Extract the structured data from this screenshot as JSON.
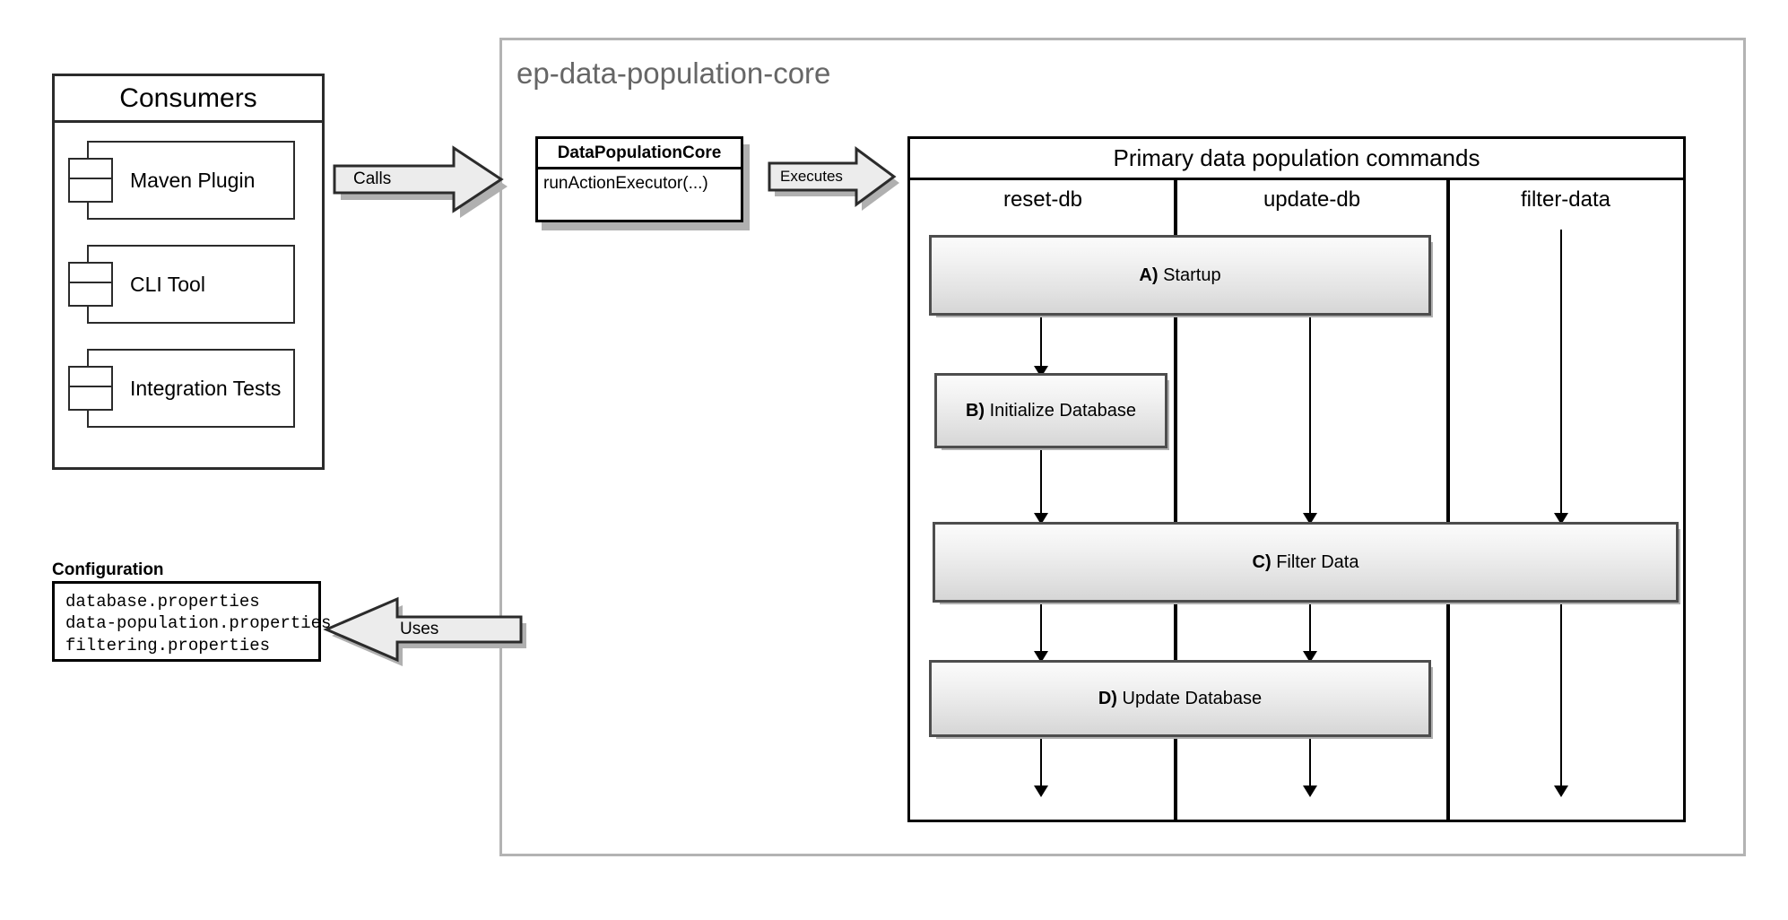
{
  "consumers": {
    "title": "Consumers",
    "components": [
      {
        "label": "Maven Plugin"
      },
      {
        "label": "CLI Tool"
      },
      {
        "label": "Integration Tests"
      }
    ]
  },
  "configuration": {
    "title": "Configuration",
    "files": [
      "database.properties",
      "data-population.properties",
      "filtering.properties"
    ]
  },
  "package": {
    "title": "ep-data-population-core"
  },
  "class_box": {
    "name": "DataPopulationCore",
    "method": "runActionExecutor(...)"
  },
  "arrows": {
    "calls": "Calls",
    "executes": "Executes",
    "uses": "Uses"
  },
  "lanes": {
    "header": "Primary data population commands",
    "columns": [
      "reset-db",
      "update-db",
      "filter-data"
    ]
  },
  "activities": [
    {
      "step": "A)",
      "label": "Startup"
    },
    {
      "step": "B)",
      "label": "Initialize Database"
    },
    {
      "step": "C)",
      "label": "Filter Data"
    },
    {
      "step": "D)",
      "label": "Update Database"
    }
  ],
  "colors": {
    "package_border": "#b3b3b3",
    "package_title": "#666666",
    "ink": "#000000",
    "box_border": "#4d4d4d",
    "shadow": "#b0b0b0",
    "arrow_fill": "#ececec"
  }
}
